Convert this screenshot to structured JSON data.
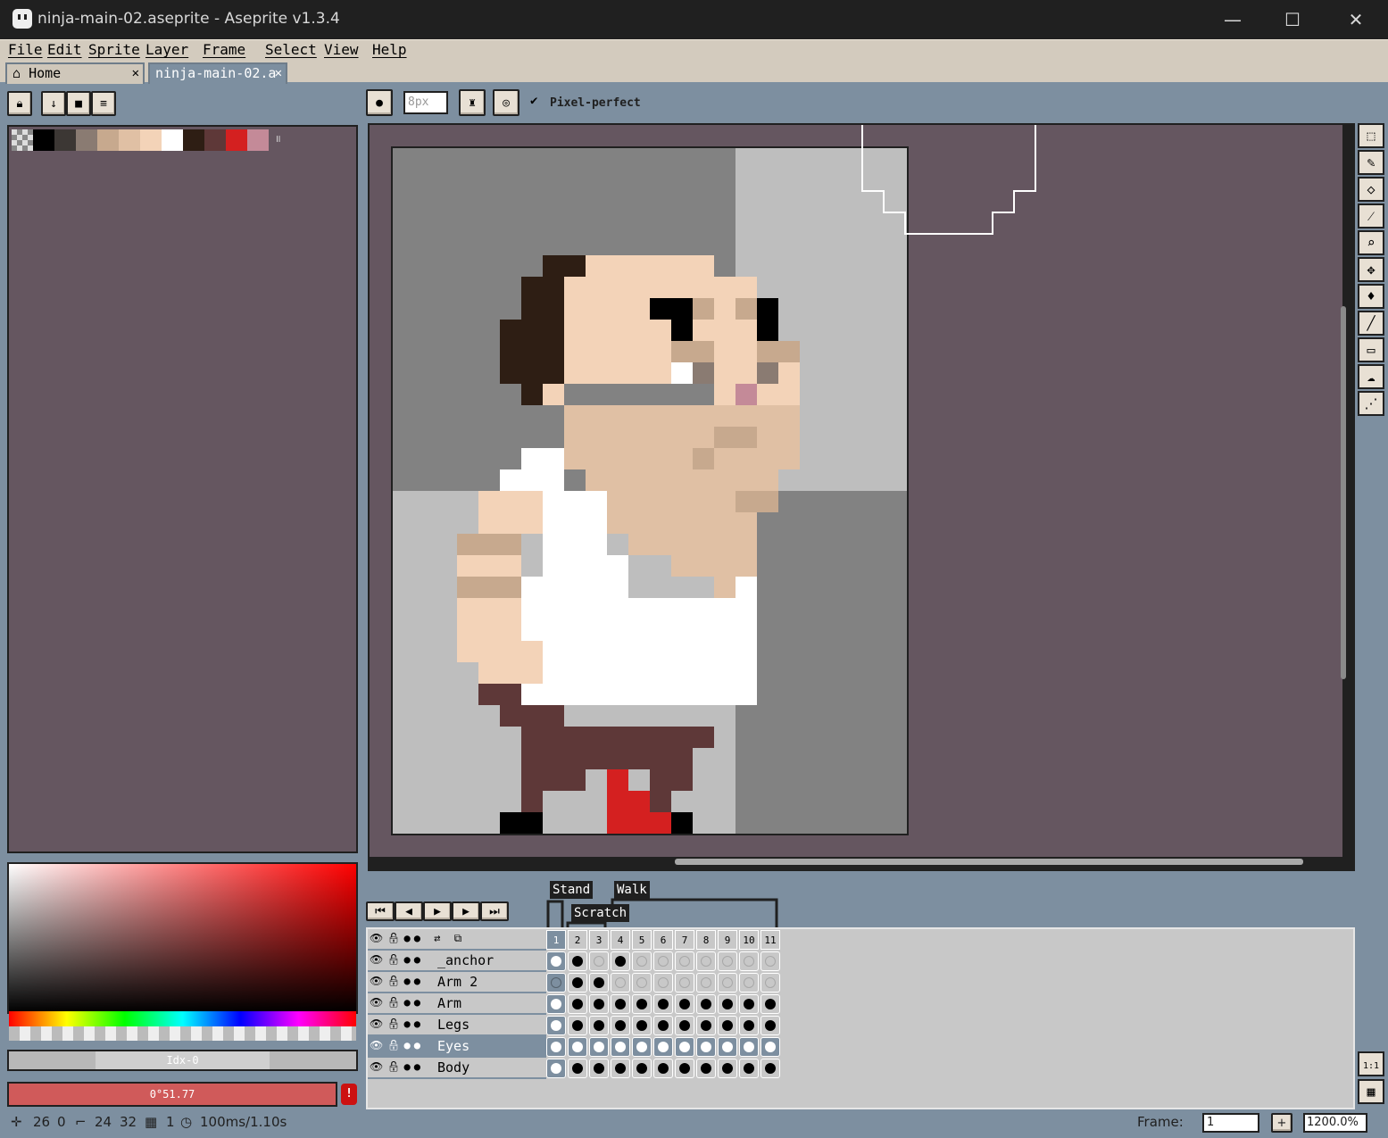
{
  "window": {
    "title": "ninja-main-02.aseprite - Aseprite v1.3.4"
  },
  "menu": [
    "File",
    "Edit",
    "Sprite",
    "Layer",
    "Frame",
    "Select",
    "View",
    "Help"
  ],
  "tabs": [
    {
      "label": "Home",
      "close": "✕"
    },
    {
      "label": "ninja-main-02.a",
      "close": "✕"
    }
  ],
  "context_bar": {
    "brush_size": "8px",
    "pixel_perfect_label": "Pixel-perfect",
    "pixel_perfect_checked": true
  },
  "palette": {
    "colors": [
      "#000000",
      "#3c3734",
      "#8a7b72",
      "#c7a98e",
      "#e0c0a4",
      "#f3d3b8",
      "#ffffff",
      "#2e1e14",
      "#5e3838",
      "#d42020",
      "#c48a98"
    ]
  },
  "color_bar": {
    "index_label": "Idx-0",
    "hex_label": "0°51.77",
    "warning": "!"
  },
  "timeline": {
    "tags": [
      {
        "name": "Stand"
      },
      {
        "name": "Walk"
      },
      {
        "name": "Scratch"
      }
    ],
    "frames": [
      "1",
      "2",
      "3",
      "4",
      "5",
      "6",
      "7",
      "8",
      "9",
      "10",
      "11"
    ],
    "layers": [
      {
        "name": "_anchor",
        "cels": "wbebeeeeeee"
      },
      {
        "name": "Arm 2",
        "cels": "gbbeeeeeeee"
      },
      {
        "name": "Arm",
        "cels": "wbbbbbbbbbb"
      },
      {
        "name": "Legs",
        "cels": "wbbbbbbbbbb"
      },
      {
        "name": "Eyes",
        "cels": "wwwwwwwwwww",
        "selected": true
      },
      {
        "name": "Body",
        "cels": "wbbbbbbbbbb"
      }
    ]
  },
  "status": {
    "cursor_x": "26",
    "cursor_y": "0",
    "sprite_w": "24",
    "sprite_h": "32",
    "frame_no": "1",
    "duration": "100ms/1.10s",
    "frame_label": "Frame:",
    "frame_value": "1",
    "zoom": "1200.0%"
  }
}
